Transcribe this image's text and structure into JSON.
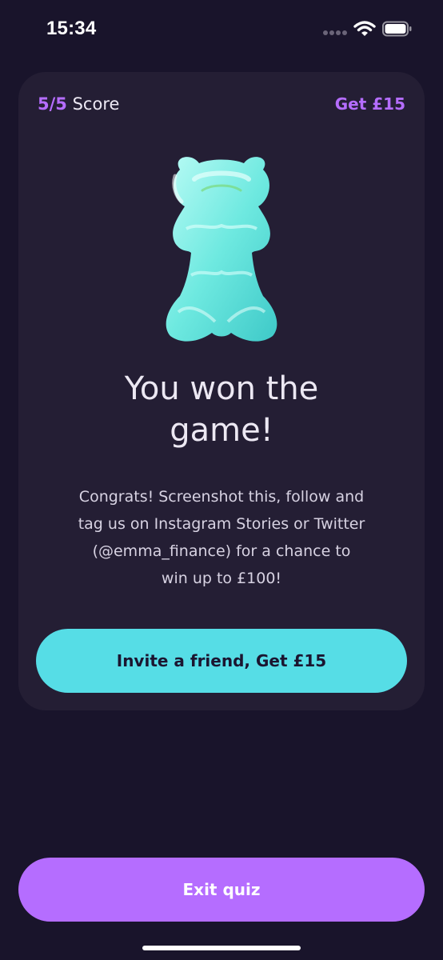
{
  "status_bar": {
    "time": "15:34",
    "signal_icon": "signal-dots-icon",
    "wifi_icon": "wifi-icon",
    "battery_icon": "battery-icon"
  },
  "card": {
    "score_value": "5/5",
    "score_label": "Score",
    "reward_label": "Get £15",
    "image": "gummy-bear-image",
    "title_line1": "You won the",
    "title_line2": "game!",
    "message_lines": [
      "Congrats! Screenshot this, follow and",
      "tag us on Instagram Stories or Twitter",
      "(@emma_finance) for a chance to",
      "win up to £100!"
    ],
    "invite_button_label": "Invite a friend, Get £15"
  },
  "footer": {
    "exit_button_label": "Exit quiz"
  },
  "colors": {
    "background": "#19142b",
    "card": "#241e34",
    "accent_purple": "#b56dff",
    "accent_cyan": "#56dde6",
    "text_primary": "#ece8f3"
  }
}
